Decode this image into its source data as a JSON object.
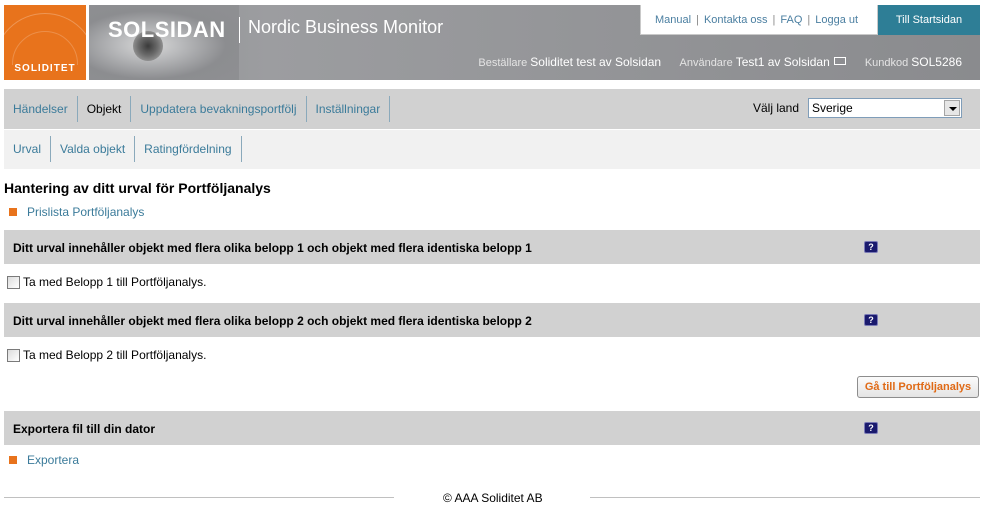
{
  "header": {
    "logo_text": "SOLIDITET",
    "brand": "SOLSIDAN",
    "product": "Nordic Business Monitor",
    "top_links": [
      "Manual",
      "Kontakta oss",
      "FAQ",
      "Logga ut"
    ],
    "start_button": "Till Startsidan",
    "orderer_label": "Beställare",
    "orderer_value": "Soliditet test av Solsidan",
    "user_label": "Användare",
    "user_value": "Test1 av Solsidan",
    "customer_code_label": "Kundkod",
    "customer_code_value": "SOL5286"
  },
  "nav": {
    "main_items": [
      "Händelser",
      "Objekt",
      "Uppdatera bevakningsportfölj",
      "Inställningar"
    ],
    "active_item": "Objekt",
    "country_label": "Välj land",
    "country_value": "Sverige",
    "sub_items": [
      "Urval",
      "Valda objekt",
      "Ratingfördelning"
    ]
  },
  "main": {
    "title": "Hantering av ditt urval för Portföljanalys",
    "price_list_link": "Prislista Portföljanalys",
    "section1_title": "Ditt urval innehåller objekt med flera olika belopp 1 och objekt med flera identiska belopp 1",
    "checkbox1_label": "Ta med Belopp 1 till Portföljanalys.",
    "section2_title": "Ditt urval innehåller objekt med flera olika belopp 2 och objekt med flera identiska belopp 2",
    "checkbox2_label": "Ta med Belopp 2 till Portföljanalys.",
    "goto_button": "Gå till Portföljanalys",
    "export_title": "Exportera fil till din dator",
    "export_link": "Exportera",
    "help_glyph": "?"
  },
  "footer": {
    "text": "© AAA Soliditet AB"
  },
  "colors": {
    "accent_orange": "#e8731c",
    "link_blue": "#3b7b9a",
    "start_button_teal": "#2e7e96"
  }
}
